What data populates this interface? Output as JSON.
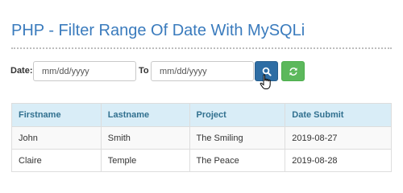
{
  "page": {
    "title": "PHP - Filter Range Of Date With MySQLi"
  },
  "filter": {
    "date_label": "Date:",
    "to_label": "To",
    "from_placeholder": "mm/dd/yyyy",
    "to_placeholder": "mm/dd/yyyy",
    "search_icon": "search-icon",
    "refresh_icon": "refresh-icon",
    "search_color": "#2e6da4",
    "refresh_color": "#5cb85c"
  },
  "table": {
    "headers": [
      "Firstname",
      "Lastname",
      "Project",
      "Date Submit"
    ],
    "header_color": "#d9edf7",
    "rows": [
      [
        "John",
        "Smith",
        "The Smiling",
        "2019-08-27"
      ],
      [
        "Claire",
        "Temple",
        "The Peace",
        "2019-08-28"
      ]
    ]
  }
}
